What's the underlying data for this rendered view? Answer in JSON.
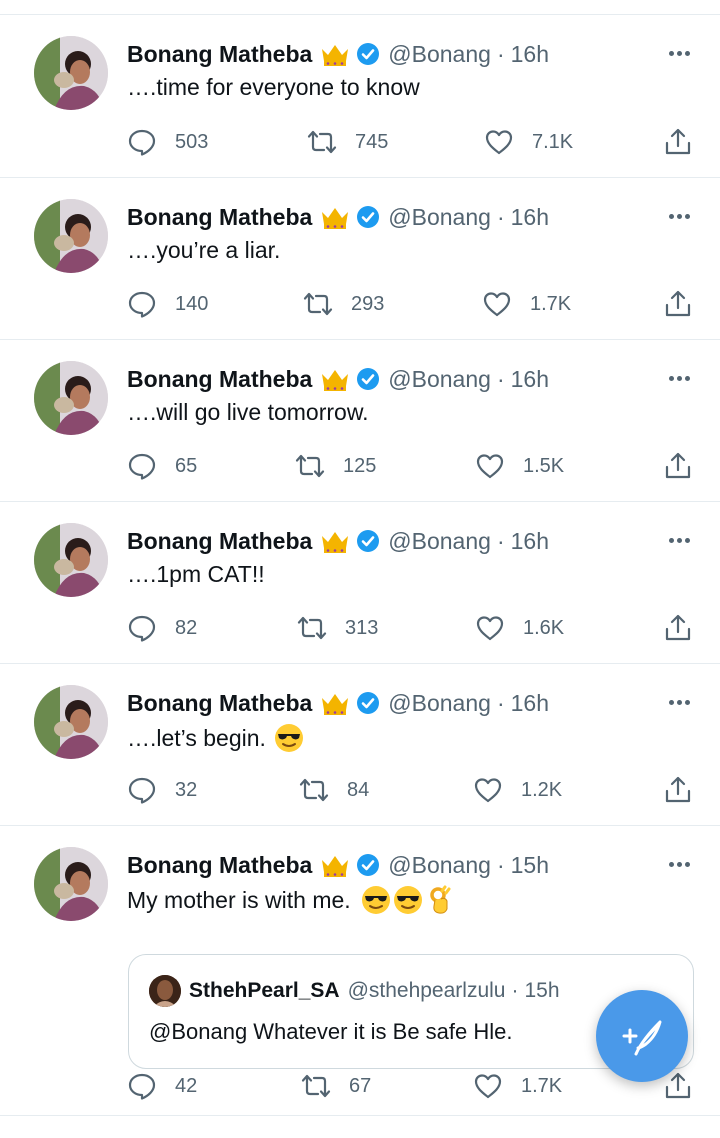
{
  "colors": {
    "accent": "#1d9bf0",
    "fab": "#4a99e9",
    "muted": "#536471",
    "text": "#0f1419",
    "divider": "#e6ecf0"
  },
  "tweets": [
    {
      "name": "Bonang Matheba",
      "handle": "@Bonang",
      "dot": "·",
      "time": "16h",
      "text": "….time for everyone to know",
      "emojis": [],
      "replies": "503",
      "retweets": "745",
      "likes": "7.1K"
    },
    {
      "name": "Bonang Matheba",
      "handle": "@Bonang",
      "dot": "·",
      "time": "16h",
      "text": "….you’re a liar.",
      "emojis": [],
      "replies": "140",
      "retweets": "293",
      "likes": "1.7K"
    },
    {
      "name": "Bonang Matheba",
      "handle": "@Bonang",
      "dot": "·",
      "time": "16h",
      "text": "….will go live tomorrow.",
      "emojis": [],
      "replies": "65",
      "retweets": "125",
      "likes": "1.5K"
    },
    {
      "name": "Bonang Matheba",
      "handle": "@Bonang",
      "dot": "·",
      "time": "16h",
      "text": "….1pm CAT!!",
      "emojis": [],
      "replies": "82",
      "retweets": "313",
      "likes": "1.6K"
    },
    {
      "name": "Bonang Matheba",
      "handle": "@Bonang",
      "dot": "·",
      "time": "16h",
      "text": "….let’s begin.",
      "emojis": [
        "sunglasses-emoji"
      ],
      "replies": "32",
      "retweets": "84",
      "likes": "1.2K"
    },
    {
      "name": "Bonang Matheba",
      "handle": "@Bonang",
      "dot": "·",
      "time": "15h",
      "text": "My mother is with me.",
      "emojis": [
        "sunglasses-emoji",
        "sunglasses-emoji",
        "ok-hand-emoji"
      ],
      "replies": "42",
      "retweets": "67",
      "likes": "1.7K",
      "quote": {
        "name": "SthehPearl_SA",
        "handle": "@sthehpearlzulu",
        "dot": "·",
        "time": "15h",
        "text": "@Bonang Whatever it is Be safe Hle."
      }
    }
  ],
  "icons": {
    "crown": "crown-icon",
    "verified": "verified-badge-icon",
    "more": "more-options-icon",
    "reply": "reply-icon",
    "retweet": "retweet-icon",
    "like": "like-icon",
    "share": "share-icon",
    "compose": "compose-tweet-icon"
  }
}
